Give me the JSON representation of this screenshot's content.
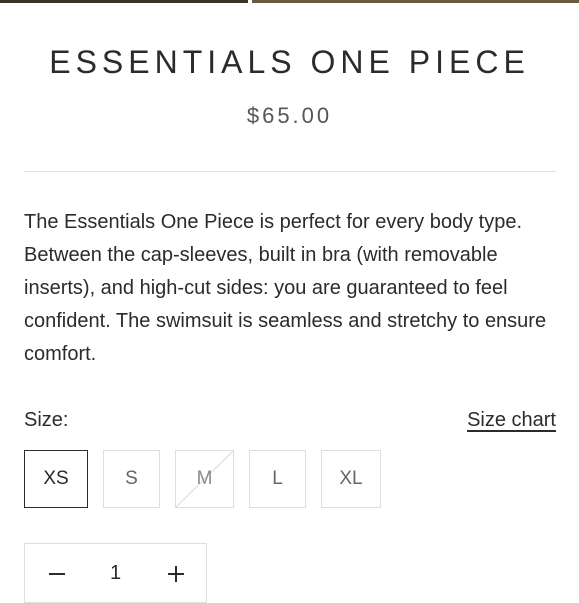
{
  "product": {
    "title": "ESSENTIALS ONE PIECE",
    "price": "$65.00",
    "description": "The Essentials One Piece is perfect for every body type. Between the cap-sleeves, built in bra (with removable inserts), and high-cut sides: you are guaranteed to feel confident. The swimsuit is seamless and stretchy to ensure comfort."
  },
  "size": {
    "label": "Size:",
    "chart_link": "Size chart",
    "options": [
      {
        "label": "XS",
        "state": "selected"
      },
      {
        "label": "S",
        "state": "available"
      },
      {
        "label": "M",
        "state": "unavailable"
      },
      {
        "label": "L",
        "state": "available"
      },
      {
        "label": "XL",
        "state": "available"
      }
    ]
  },
  "quantity": {
    "value": "1"
  },
  "colors": {
    "text": "#2b2b2b",
    "price": "#555555",
    "border": "#dedede"
  }
}
